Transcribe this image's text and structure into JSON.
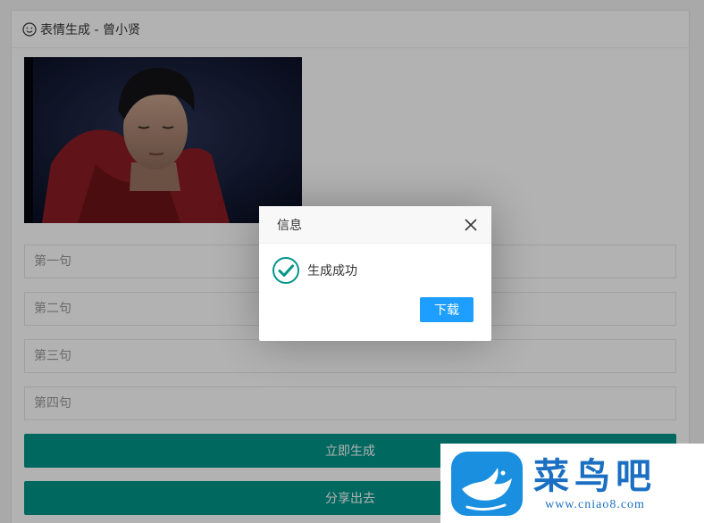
{
  "panel": {
    "title": "表情生成 - 曾小贤",
    "title_icon": "smile-icon"
  },
  "preview": {
    "description_icon": "gif-preview"
  },
  "inputs": [
    {
      "placeholder": "第一句",
      "value": ""
    },
    {
      "placeholder": "第二句",
      "value": ""
    },
    {
      "placeholder": "第三句",
      "value": ""
    },
    {
      "placeholder": "第四句",
      "value": ""
    }
  ],
  "buttons": {
    "generate": "立即生成",
    "share": "分享出去"
  },
  "dialog": {
    "title": "信息",
    "message": "生成成功",
    "download": "下载",
    "success_icon_color": "#009688",
    "button_color": "#1e9fff"
  },
  "watermark": {
    "name": "菜鸟吧",
    "url": "www.cniao8.com",
    "brand_color": "#1a6fc2"
  },
  "colors": {
    "primary_green": "#009688",
    "page_bg": "#f2f2f2"
  }
}
